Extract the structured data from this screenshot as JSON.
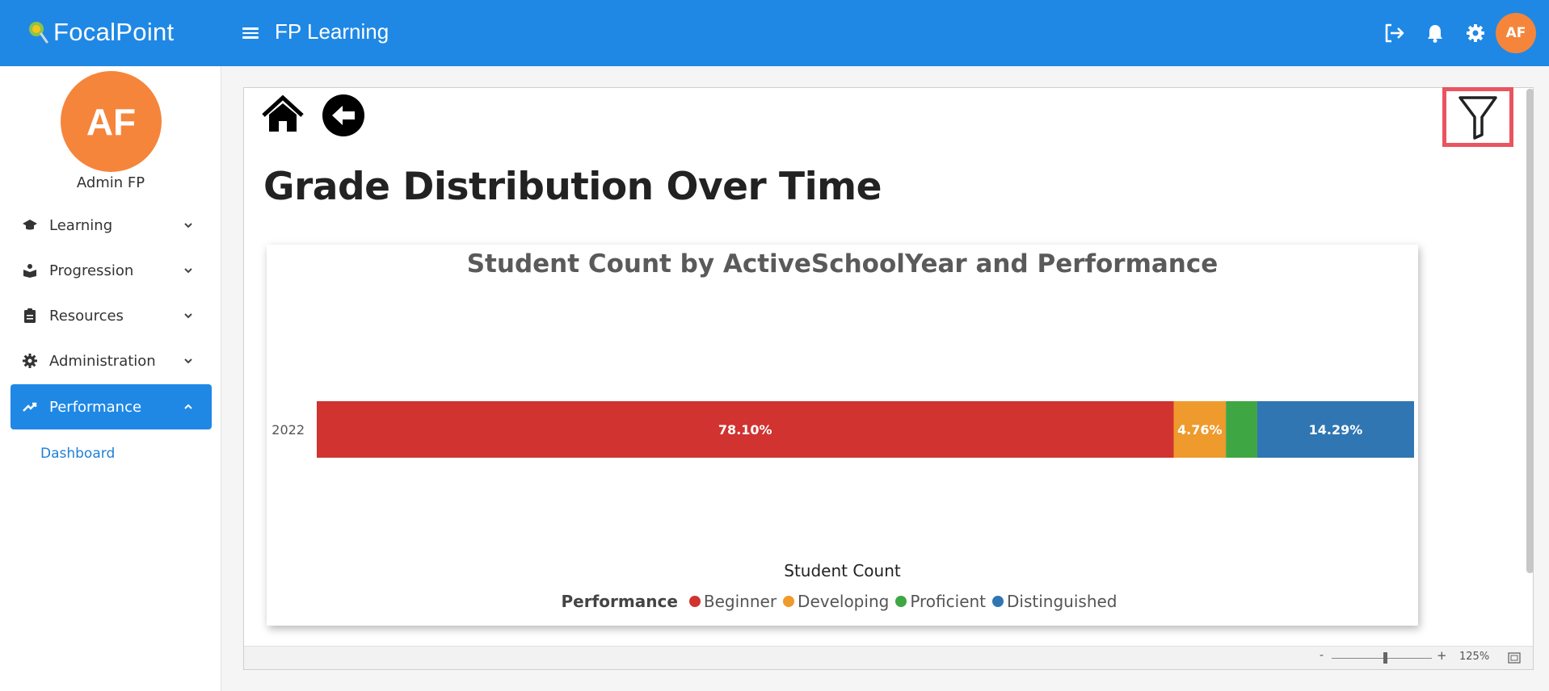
{
  "header": {
    "brand_name": "FocalPoint",
    "app_title": "FP Learning",
    "avatar_initials": "AF",
    "accent_color": "#1f88e5"
  },
  "sidebar": {
    "avatar_initials": "AF",
    "user_name": "Admin FP",
    "items": [
      {
        "label": "Learning",
        "icon": "graduation-cap-icon"
      },
      {
        "label": "Progression",
        "icon": "book-reader-icon"
      },
      {
        "label": "Resources",
        "icon": "clipboard-icon"
      },
      {
        "label": "Administration",
        "icon": "gear-icon"
      },
      {
        "label": "Performance",
        "icon": "trending-up-icon"
      }
    ],
    "active_item": "Performance",
    "sub_item": "Dashboard"
  },
  "main": {
    "page_title": "Grade Distribution Over Time",
    "zoom": {
      "minus": "-",
      "plus": "+",
      "level": "125%"
    }
  },
  "chart_data": {
    "type": "bar",
    "orientation": "horizontal-stacked",
    "title": "Student Count by ActiveSchoolYear and Performance",
    "xlabel": "Student Count",
    "ylabel": "",
    "categories": [
      "2022"
    ],
    "legend_title": "Performance",
    "legend_position": "bottom",
    "series": [
      {
        "name": "Beginner",
        "values": [
          78.1
        ],
        "label": "78.10%",
        "color": "#d13330"
      },
      {
        "name": "Developing",
        "values": [
          4.76
        ],
        "label": "4.76%",
        "color": "#ef9a2c"
      },
      {
        "name": "Proficient",
        "values": [
          2.86
        ],
        "label": "",
        "color": "#3fa644"
      },
      {
        "name": "Distinguished",
        "values": [
          14.29
        ],
        "label": "14.29%",
        "color": "#2f76b2"
      }
    ]
  }
}
